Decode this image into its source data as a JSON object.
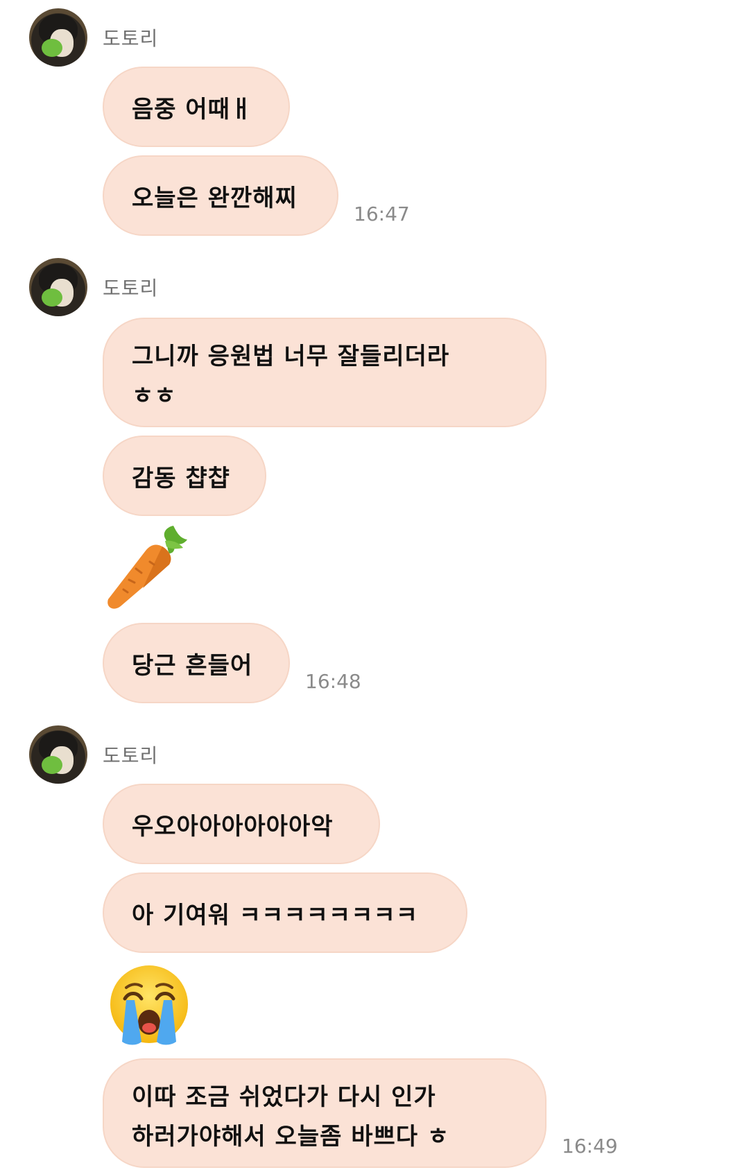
{
  "sender": "도토리",
  "groups": [
    {
      "name": "도토리",
      "messages": [
        "음중 어때ㅐ",
        "오늘은 완깐해찌"
      ],
      "time": "16:47"
    },
    {
      "name": "도토리",
      "messages": [
        "그니까 응원법 너무 잘들리더라\nㅎㅎ",
        "감동 챱챱",
        "당근 흔들어"
      ],
      "time": "16:48",
      "sticker": "carrot-emoji"
    },
    {
      "name": "도토리",
      "messages": [
        "우오아아아아아아악",
        "아 기여워 ㅋㅋㅋㅋㅋㅋㅋㅋ",
        "이따 조금 쉬었다가 다시 인가\n하러가야해서 오늘좀 바쁘다 ㅎ"
      ],
      "time": "16:49",
      "sticker": "loudly-crying-face-emoji"
    }
  ],
  "colors": {
    "bubble": "#fbe2d6",
    "bubble_border": "#f6d6c6",
    "name": "#6f6f6f",
    "time": "#8a8a8a"
  }
}
